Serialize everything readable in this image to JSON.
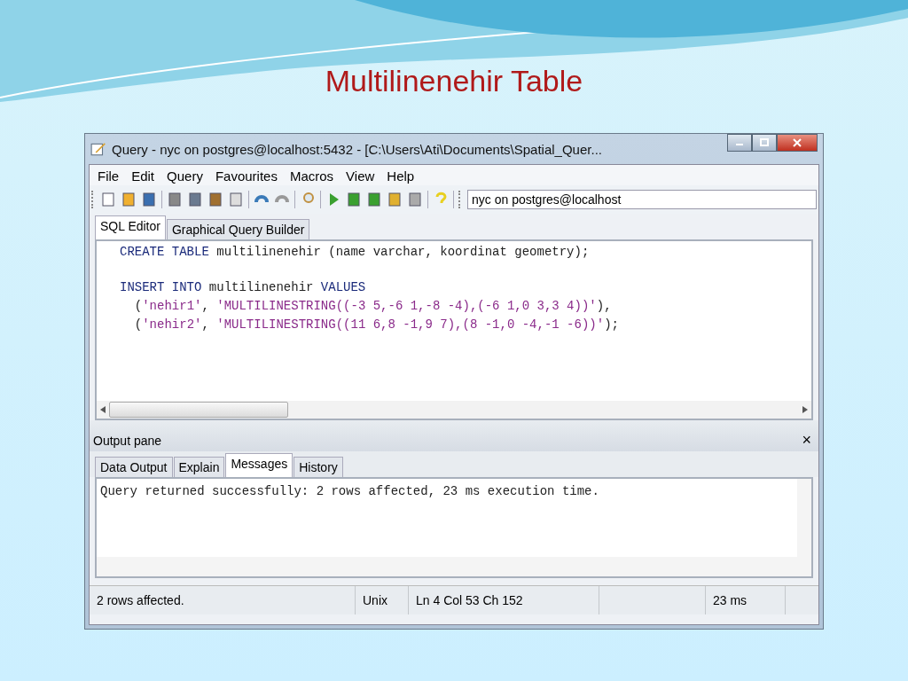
{
  "slide_title": "Multilinenehir Table",
  "window": {
    "title": "Query - nyc on postgres@localhost:5432 - [C:\\Users\\Ati\\Documents\\Spatial_Quer..."
  },
  "menu": [
    "File",
    "Edit",
    "Query",
    "Favourites",
    "Macros",
    "View",
    "Help"
  ],
  "connection_combo": {
    "value": "nyc on postgres@localhost"
  },
  "editor_tabs": [
    {
      "label": "SQL Editor",
      "selected": true
    },
    {
      "label": "Graphical Query Builder",
      "selected": false
    }
  ],
  "sql": {
    "statements": [
      {
        "lines": [
          [
            {
              "kind": "keyword",
              "text": "CREATE TABLE"
            },
            {
              "kind": "plain",
              "text": " multilinenehir (name varchar, koordinat geometry);"
            }
          ]
        ]
      },
      {
        "lines": [
          [
            {
              "kind": "keyword",
              "text": "INSERT INTO"
            },
            {
              "kind": "plain",
              "text": " multilinenehir "
            },
            {
              "kind": "keyword",
              "text": "VALUES"
            }
          ],
          [
            {
              "kind": "plain",
              "text": "  ("
            },
            {
              "kind": "string",
              "text": "'nehir1'"
            },
            {
              "kind": "plain",
              "text": ", "
            },
            {
              "kind": "string",
              "text": "'MULTILINESTRING((-3 5,-6 1,-8 -4),(-6 1,0 3,3 4))'"
            },
            {
              "kind": "plain",
              "text": "),"
            }
          ],
          [
            {
              "kind": "plain",
              "text": "  ("
            },
            {
              "kind": "string",
              "text": "'nehir2'"
            },
            {
              "kind": "plain",
              "text": ", "
            },
            {
              "kind": "string",
              "text": "'MULTILINESTRING((11 6,8 -1,9 7),(8 -1,0 -4,-1 -6))'"
            },
            {
              "kind": "plain",
              "text": ");"
            }
          ]
        ]
      }
    ]
  },
  "output_pane": {
    "title": "Output pane",
    "close": "×",
    "tabs": [
      {
        "label": "Data Output",
        "selected": false
      },
      {
        "label": "Explain",
        "selected": false
      },
      {
        "label": "Messages",
        "selected": true
      },
      {
        "label": "History",
        "selected": false
      }
    ],
    "message": "Query returned successfully: 2 rows affected, 23 ms execution time."
  },
  "status_bar": [
    "2 rows affected.",
    "Unix",
    "Ln 4 Col 53 Ch 152",
    "23 ms"
  ]
}
